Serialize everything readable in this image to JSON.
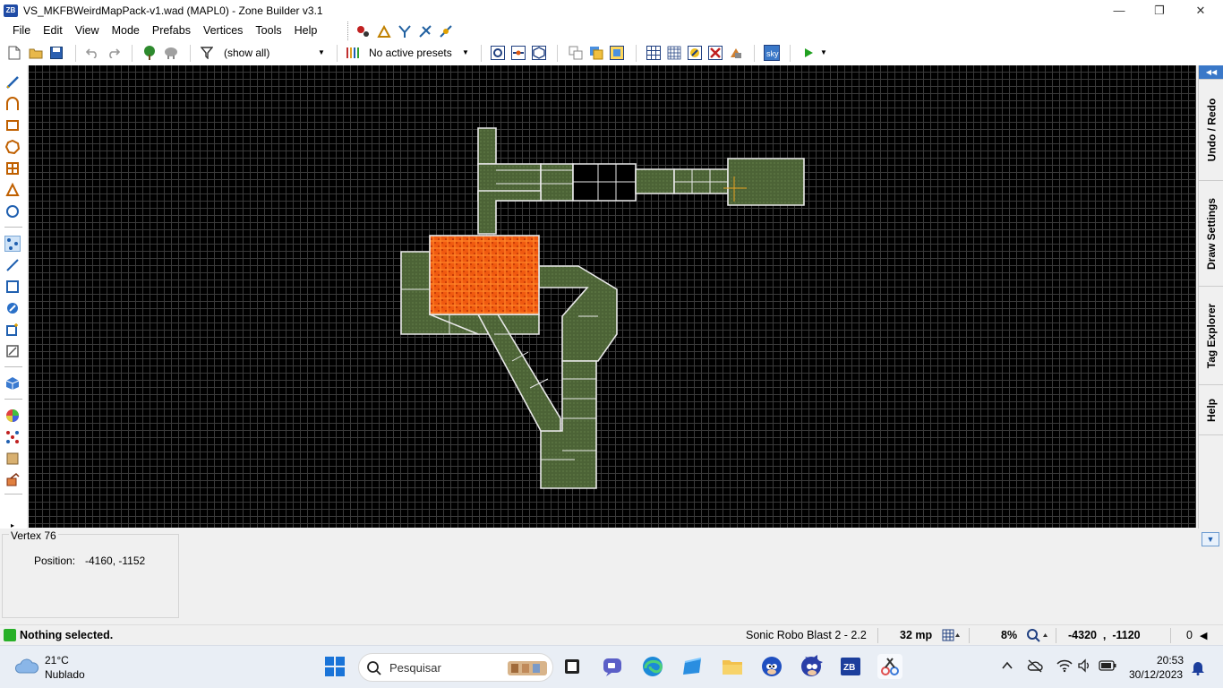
{
  "window": {
    "app_icon_text": "ZB",
    "title": "VS_MKFBWeirdMapPack-v1.wad (MAPL0) - Zone Builder v3.1",
    "minimize": "—",
    "restore": "❐",
    "close": "✕"
  },
  "menu": [
    "File",
    "Edit",
    "View",
    "Mode",
    "Prefabs",
    "Vertices",
    "Tools",
    "Help"
  ],
  "toolbar": {
    "filter_label": "(show all)",
    "presets_label": "No active presets"
  },
  "right_dock": {
    "collapse_label": "◀◀",
    "tabs": [
      "Undo / Redo",
      "Draw Settings",
      "Tag Explorer",
      "Help"
    ]
  },
  "info_panel": {
    "title": "Vertex 76",
    "position_label": "Position:",
    "position_value": "-4160, -1152"
  },
  "status": {
    "message": "Nothing selected.",
    "game_config": "Sonic Robo Blast 2 - 2.2",
    "grid_size": "32 mp",
    "zoom": "8%",
    "coords": "-4320  ,  -1120",
    "count": "0"
  },
  "taskbar": {
    "weather_temp": "21°C",
    "weather_desc": "Nublado",
    "search_placeholder": "Pesquisar",
    "time": "20:53",
    "date": "30/12/2023"
  },
  "colors": {
    "sector_fill": "#4f6639",
    "sector_line": "#e8e8e8",
    "selected_sector": "#f05a10",
    "canvas_bg": "#000000",
    "grid": "#3a3a3a"
  }
}
